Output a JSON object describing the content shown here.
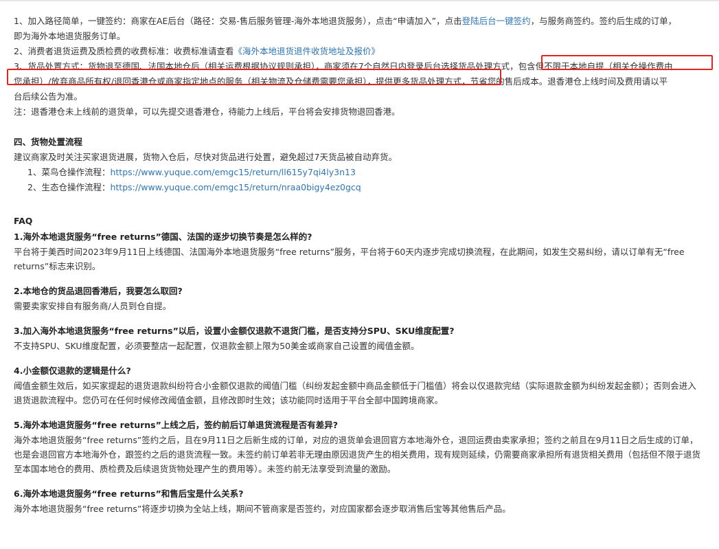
{
  "section3": {
    "p1_a": "1、加入路径简单，一键签约：商家在AE后台（路径：交易-售后服务管理-海外本地退货服务），点击“申请加入”，点击",
    "p1_link": "登陆后台一键签约",
    "p1_b": "，与服务商签约。签约后生成的订单，",
    "p1_c": "即为海外本地退货服务订单。",
    "p2_a": "2、消费者退货运费及质检费的收费标准：收费标准请查看",
    "p2_link": "《海外本地退货退件收货地址及报价》",
    "p3_a": "3、货品处置方式：货物退至德国、法国本地仓后（相关运费根据协议规则承担），商家须在7个自然日内登录后台选择货品处理方式，",
    "p3_hl1": "包含但不限于本地自提（相关仓操作费由",
    "p3_hl2": "您承担）/放弃商品所有权/退回香港仓或商家指定地点的服务（相关物流及仓储费需要您承担），提供更多货品处理方式，",
    "p3_b": "节省您的售后成本。退香港仓上线时间及费用请以平",
    "p3_c": "台后续公告为准。",
    "note": "注：退香港仓未上线前的退货单，可以先提交退香港仓，待能力上线后，平台将会安排货物退回香港。"
  },
  "section4": {
    "title": "四、货物处置流程",
    "intro": "建议商家及时关注买家退货进展，货物入仓后，尽快对货品进行处置，避免超过7天货品被自动弃货。",
    "items": [
      {
        "label": "1、菜鸟仓操作流程：",
        "url": "https://www.yuque.com/emgc15/return/ll615y7qi4ly3n13"
      },
      {
        "label": "2、生态仓操作流程：",
        "url": "https://www.yuque.com/emgc15/return/nraa0bigy4ez0gcq"
      }
    ]
  },
  "faq": {
    "title": "FAQ",
    "items": [
      {
        "q": "1.海外本地退货服务“free returns”德国、法国的逐步切换节奏是怎么样的?",
        "a": "平台将于美西时间2023年9月11日上线德国、法国海外本地退货服务“free returns”服务，平台将于60天内逐步完成切换流程，在此期间，如发生交易纠纷，请以订单有无“free returns”标志来识别。"
      },
      {
        "q": "2.本地仓的货品退回香港后，我要怎么取回?",
        "a": "需要卖家安排自有服务商/人员到仓自提。"
      },
      {
        "q": "3.加入海外本地退货服务“free returns”以后，设置小金额仅退款不退货门槛，是否支持分SPU、SKU维度配置?",
        "a": "不支持SPU、SKU维度配置，必须要整店一起配置，仅退款金额上限为50美金或商家自己设置的阈值金额。"
      },
      {
        "q": "4.小金额仅退款的逻辑是什么?",
        "a": "阈值金额生效后，如买家提起的退货退款纠纷符合小金额仅退款的阈值门槛（纠纷发起金额中商品金额低于门槛值）将会以仅退款完结（实际退款金额为纠纷发起金额）；否则会进入退货退款流程中。您仍可在任何时候修改阈值金额，且修改即时生效；该功能同时适用于平台全部中国跨境商家。"
      },
      {
        "q": "5.海外本地退货服务“free returns”上线之后，签约前后订单退货流程是否有差异?",
        "a": "海外本地退货服务“free returns”签约之后，且在9月11日之后新生成的订单，对应的退货单会退回官方本地海外仓，退回运费由卖家承担；签约之前且在9月11日之后生成的订单，也是会退回官方本地海外仓，跟签约之后的退货流程一致。未签约前订单若非无理由原因退货产生的相关费用，现有规则延续，仍需要商家承担所有退货相关费用（包括但不限于退货至本国本地仓的费用、质检费及后续退货货物处理产生的费用等）。未签约前无法享受到流量的激励。"
      },
      {
        "q": "6.海外本地退货服务“free returns”和售后宝是什么关系?",
        "a": "海外本地退货服务“free returns”将逐步切换为全站上线，期间不管商家是否签约，对应国家都会逐步取消售后宝等其他售后产品。"
      }
    ]
  },
  "colors": {
    "link": "#2e75b6",
    "highlight_box": "#e0271e",
    "text": "#333333"
  }
}
